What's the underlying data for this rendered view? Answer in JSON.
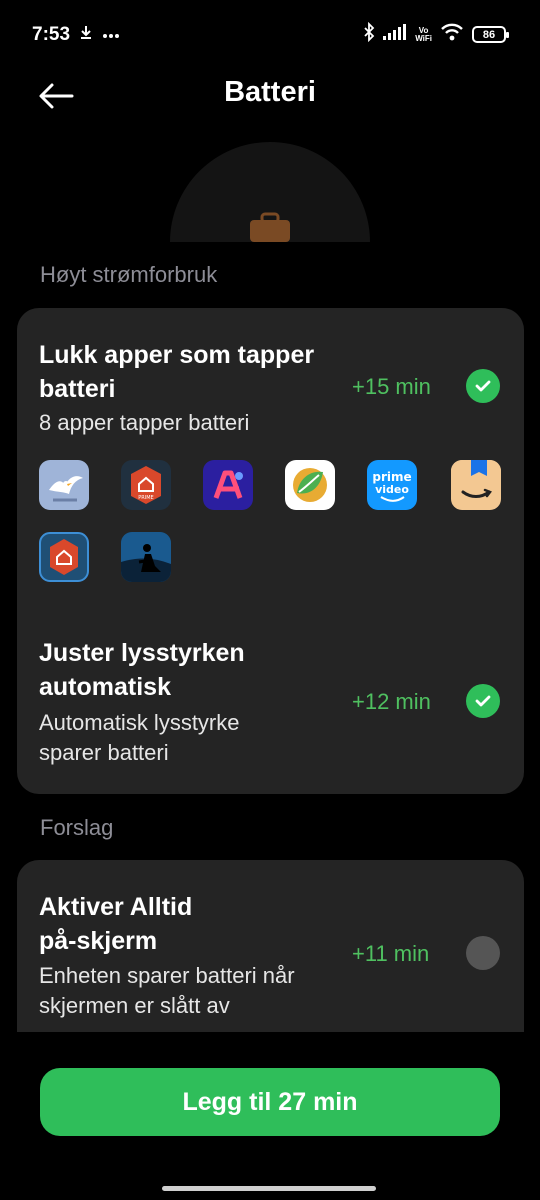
{
  "status_bar": {
    "time": "7:53",
    "wifi_label_top": "Vo",
    "wifi_label_bottom": "WiFi",
    "battery_level": "86",
    "icons": [
      "download-icon",
      "more-icon",
      "bluetooth-icon",
      "signal-icon",
      "wifi-icon",
      "battery-icon"
    ]
  },
  "header": {
    "title": "Batteri"
  },
  "sections": {
    "high_usage": "Høyt strømforbruk",
    "suggestions": "Forslag"
  },
  "high_usage_items": [
    {
      "title_line1": "Lukk apper som tapper",
      "title_line2": "batteri",
      "subtitle": "8 apper tapper batteri",
      "gain": "+15 min",
      "checked": true
    },
    {
      "title_line1": "Juster lysstyrken",
      "title_line2": "automatisk",
      "subtitle_line1": "Automatisk lysstyrke",
      "subtitle_line2": "sparer batteri",
      "gain": "+12 min",
      "checked": true
    }
  ],
  "apps": [
    {
      "name": "seagull-app-icon",
      "bg": "#9fb4d8"
    },
    {
      "name": "nova-prime-app-icon",
      "bg": "#20303f"
    },
    {
      "name": "a-app-icon",
      "bg": "#2b1fa0"
    },
    {
      "name": "leaf-app-icon",
      "bg": "#ffffff"
    },
    {
      "name": "prime-video-app-icon",
      "bg": "#1399ff"
    },
    {
      "name": "amazon-app-icon",
      "bg": "#f3c892"
    },
    {
      "name": "nova-launcher-app-icon",
      "bg": "#1f4f75"
    },
    {
      "name": "kindle-app-icon",
      "bg": "#0f3a5e"
    }
  ],
  "app_labels": {
    "prime_top": "prime",
    "prime_bottom": "video",
    "nova_small": "PRIME"
  },
  "suggestion_items": [
    {
      "title_line1": "Aktiver Alltid",
      "title_line2": "på-skjerm",
      "subtitle_line1": "Enheten sparer batteri når",
      "subtitle_line2": "skjermen er slått av",
      "gain": "+11 min",
      "checked": false
    }
  ],
  "action": {
    "label": "Legg til 27 min"
  },
  "colors": {
    "accent": "#2fbe5a",
    "gain": "#4fc060",
    "card": "#242424",
    "section_label": "#8d8d96"
  }
}
